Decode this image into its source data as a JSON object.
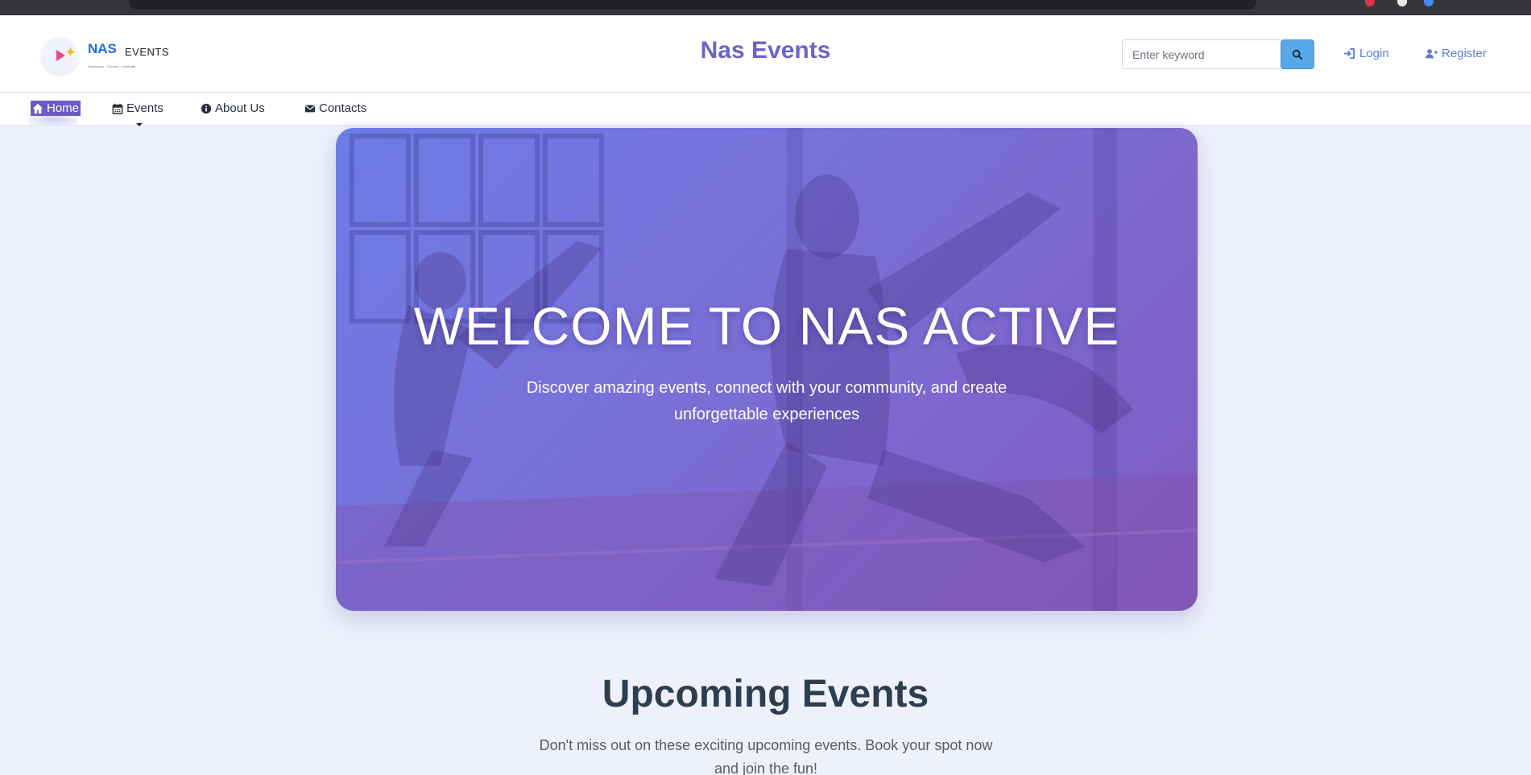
{
  "header": {
    "logo": {
      "brand": "NAS",
      "suffix": "EVENTS",
      "tagline": "Experience · Connect · Celebrate"
    },
    "site_title": "Nas Events",
    "search": {
      "placeholder": "Enter keyword"
    },
    "login_label": "Login",
    "register_label": "Register"
  },
  "nav": {
    "items": [
      {
        "label": "Home",
        "icon": "home-icon",
        "active": true
      },
      {
        "label": "Events",
        "icon": "calendar-icon"
      },
      {
        "label": "About Us",
        "icon": "info-icon"
      },
      {
        "label": "Contacts",
        "icon": "envelope-icon"
      }
    ]
  },
  "hero": {
    "title": "WELCOME TO NAS ACTIVE",
    "subtitle": "Discover amazing events, connect with your community, and create unforgettable experiences"
  },
  "upcoming": {
    "title": "Upcoming Events",
    "subtitle": "Don't miss out on these exciting upcoming events. Book your spot now and join the fun!"
  },
  "colors": {
    "accent": "#6e63c9",
    "link": "#5b7fd8",
    "search_button": "#57a8e8",
    "page_bg": "#eef1fc"
  }
}
